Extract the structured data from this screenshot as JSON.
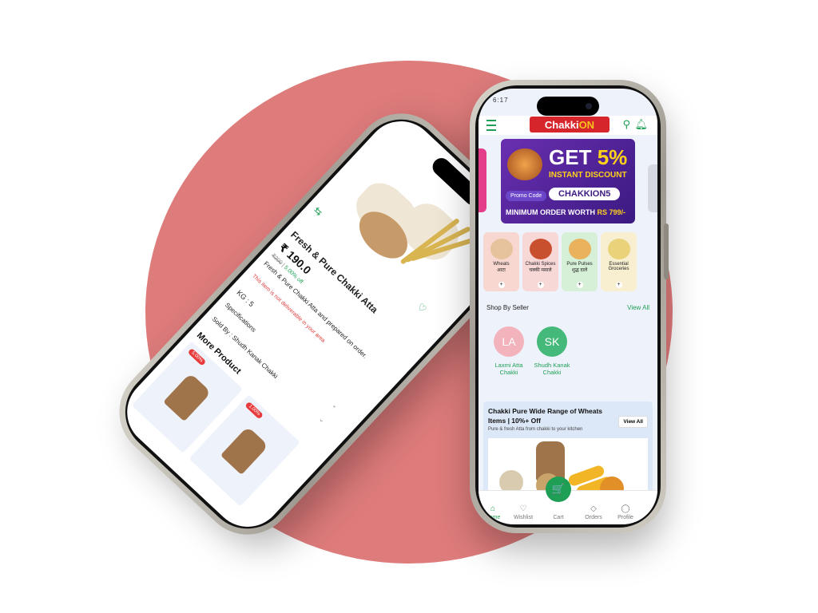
{
  "right_phone": {
    "status_time": "6:17",
    "logo": {
      "part1": "Chakki",
      "part2": "ON"
    },
    "promo": {
      "get": "GET",
      "percent": "5%",
      "instant": "INSTANT DISCOUNT",
      "code_label": "Promo Code",
      "code": "CHAKKION5",
      "minimum": "MINIMUM ORDER WORTH",
      "amount": "RS 799/-"
    },
    "categories": [
      {
        "label": "Wheats",
        "sub": "आटा",
        "color": "#f7d7cf"
      },
      {
        "label": "Chakki Spices",
        "sub": "चक्की मसाले",
        "color": "#f8d7d7"
      },
      {
        "label": "Pure Pulses",
        "sub": "शुद्ध दालें",
        "color": "#d6efd7"
      },
      {
        "label": "Essential Groceries",
        "sub": "",
        "color": "#f7efcf"
      }
    ],
    "shop_by_seller": "Shop By Seller",
    "view_all": "View All",
    "sellers": [
      {
        "initials": "LA",
        "name": "Laxmi Atta Chakki",
        "color": "#f3b3bd"
      },
      {
        "initials": "SK",
        "name": "Shudh Kanak Chakki",
        "color": "#45b97a"
      }
    ],
    "wheat_card": {
      "title": "Chakki Pure Wide Range of Wheats Items | 10%+ Off",
      "subtitle": "Pure & fresh Atta from chakki to your kitchen",
      "view_all": "View All"
    },
    "nav": [
      {
        "label": "Home",
        "icon": "⌂"
      },
      {
        "label": "Wishlist",
        "icon": "♡"
      },
      {
        "label": "Cart",
        "icon": "🛒"
      },
      {
        "label": "Orders",
        "icon": "◇"
      },
      {
        "label": "Profile",
        "icon": "◯"
      }
    ]
  },
  "left_phone": {
    "title": "Fresh & Pure Chakki Atta",
    "price": "₹ 190.0",
    "mrp": "₹200",
    "off": "5.00% off",
    "description": "Fresh & Pure Chakki Atta and prepared on order.",
    "warning": "This item is not deliverable in your area",
    "kg": "KG : 5",
    "specifications": "Specifications",
    "sold_by": "Sold By : Shudh Kanak Chakki",
    "more_product": "More Product",
    "tile_badges": [
      "5.00%",
      "1.00%"
    ]
  }
}
